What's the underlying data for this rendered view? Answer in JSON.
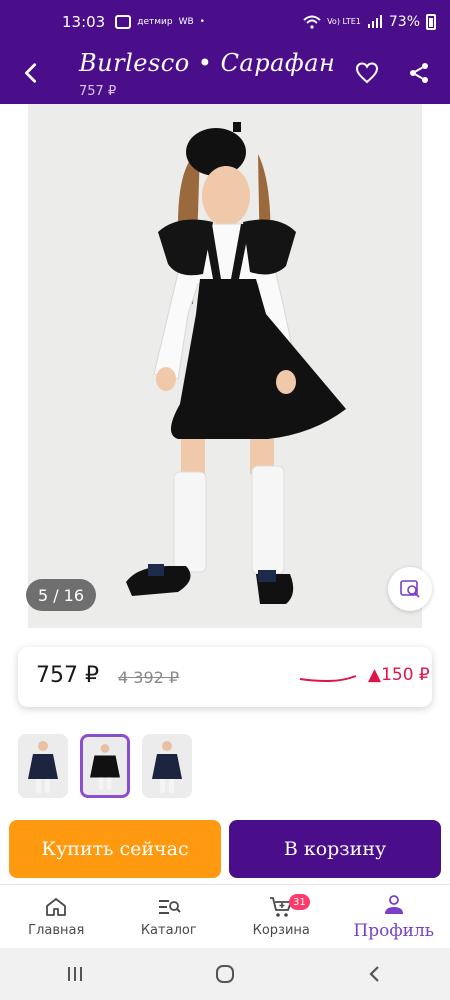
{
  "status_bar": {
    "time": "13:03",
    "mini_badges": [
      "детмир",
      "WB"
    ],
    "network": "Vo) LTE1",
    "battery": "73%"
  },
  "header": {
    "title": "Burlesco • Сарафан",
    "subtitle": "757 ₽"
  },
  "gallery": {
    "counter": "5 / 16"
  },
  "price": {
    "current": "757 ₽",
    "old": "4 392 ₽",
    "delta": "▲150 ₽",
    "delta_color": "#e0134a"
  },
  "actions": {
    "buy_now": "Купить сейчас",
    "add_to_cart": "В корзину"
  },
  "bottom_nav": [
    {
      "label": "Главная",
      "icon": "home-icon"
    },
    {
      "label": "Каталог",
      "icon": "catalog-icon"
    },
    {
      "label": "Корзина",
      "icon": "cart-icon",
      "badge": "31"
    },
    {
      "label": "Профиль",
      "icon": "profile-icon",
      "active": true
    }
  ],
  "colors": {
    "brand": "#4b0e8a",
    "accent": "#ff9910",
    "active": "#7a3fc6"
  }
}
